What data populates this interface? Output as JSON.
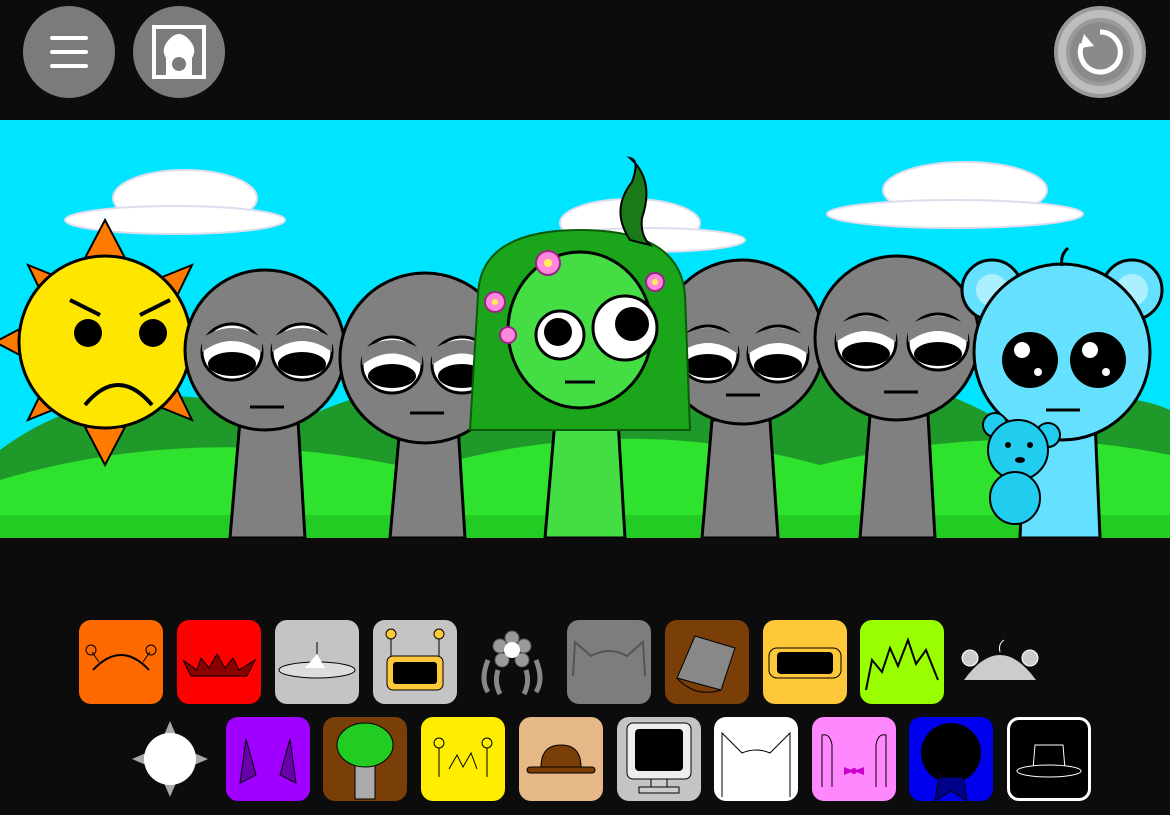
{
  "toolbar": {
    "menu_icon": "hamburger-menu-icon",
    "portrait_icon": "portrait-frame-icon",
    "reset_icon": "restart-icon"
  },
  "colors": {
    "background": "#0c0c0c",
    "sky": "#00e5ff",
    "grass": "#22dd22",
    "button_gray": "#7b7b7b"
  },
  "stage": {
    "characters": [
      {
        "name": "sun",
        "color": "#ffe600",
        "mood": "angry"
      },
      {
        "name": "gray-1",
        "color": "#808080",
        "mood": "sleepy"
      },
      {
        "name": "gray-2",
        "color": "#808080",
        "mood": "sleepy"
      },
      {
        "name": "green-plant",
        "color": "#44dd44",
        "mood": "worried"
      },
      {
        "name": "gray-3",
        "color": "#808080",
        "mood": "sleepy"
      },
      {
        "name": "gray-4",
        "color": "#808080",
        "mood": "sleepy"
      },
      {
        "name": "blue-bear",
        "color": "#66e0ff",
        "mood": "teary"
      }
    ]
  },
  "palette": {
    "row1": [
      {
        "name": "orange-antenna",
        "bg": "#ff6a00",
        "icon": "antenna-icon"
      },
      {
        "name": "red-spikes",
        "bg": "#ff0000",
        "icon": "spikes-icon"
      },
      {
        "name": "silver-ufo",
        "bg": "#c4c4c4",
        "icon": "ufo-icon"
      },
      {
        "name": "robot-screen",
        "bg": "#c4c4c4",
        "icon": "robot-screen-icon"
      },
      {
        "name": "flower-hair",
        "bg": "transparent",
        "icon": "flower-hair-icon"
      },
      {
        "name": "gray-ears",
        "bg": "#7d7d7d",
        "icon": "cat-ears-icon"
      },
      {
        "name": "brown-bucket",
        "bg": "#7a3e08",
        "icon": "bucket-icon"
      },
      {
        "name": "yellow-visor",
        "bg": "#ffc83a",
        "icon": "visor-icon"
      },
      {
        "name": "lime-hair",
        "bg": "#99ff00",
        "icon": "spiky-hair-icon"
      },
      {
        "name": "bear-ears",
        "bg": "transparent",
        "icon": "bear-ears-icon"
      }
    ],
    "row2": [
      {
        "name": "white-sun",
        "bg": "transparent",
        "icon": "sun-icon"
      },
      {
        "name": "purple-horns",
        "bg": "#a000ff",
        "icon": "horns-icon"
      },
      {
        "name": "brown-tree",
        "bg": "#7a3e08",
        "icon": "tree-icon"
      },
      {
        "name": "yellow-antenna-hair",
        "bg": "#ffee00",
        "icon": "antenna-hair-icon"
      },
      {
        "name": "tan-hat",
        "bg": "#e6b888",
        "icon": "bowler-hat-icon"
      },
      {
        "name": "computer-monitor",
        "bg": "#c4c4c4",
        "icon": "monitor-icon"
      },
      {
        "name": "white-ears",
        "bg": "#ffffff",
        "icon": "pointy-ears-icon"
      },
      {
        "name": "pink-bunny",
        "bg": "#ff88ff",
        "icon": "bunny-bow-icon"
      },
      {
        "name": "blue-ribbon",
        "bg": "#0000ee",
        "icon": "ribbon-icon"
      },
      {
        "name": "black-top-hat",
        "bg": "#000000",
        "icon": "top-hat-icon"
      }
    ]
  }
}
